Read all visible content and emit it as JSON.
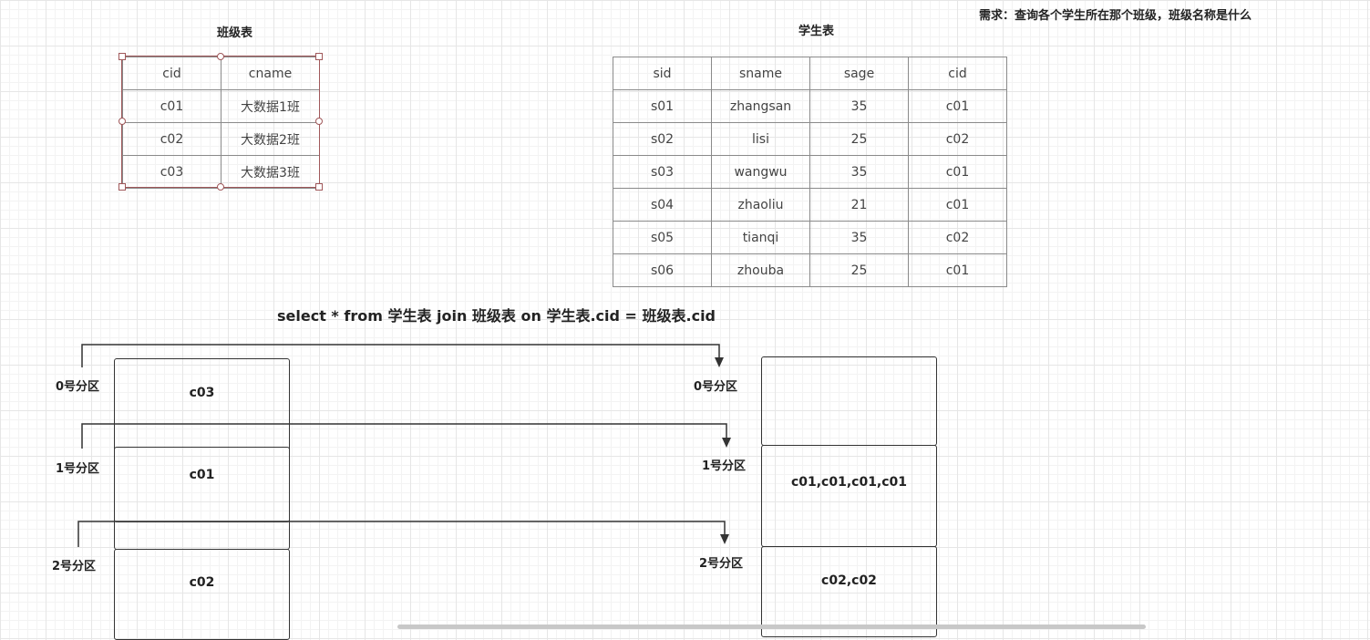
{
  "requirement": "需求：查询各个学生所在那个班级，班级名称是什么",
  "class_table": {
    "title": "班级表",
    "headers": [
      "cid",
      "cname"
    ],
    "rows": [
      [
        "c01",
        "大数据1班"
      ],
      [
        "c02",
        "大数据2班"
      ],
      [
        "c03",
        "大数据3班"
      ]
    ]
  },
  "student_table": {
    "title": "学生表",
    "headers": [
      "sid",
      "sname",
      "sage",
      "cid"
    ],
    "rows": [
      [
        "s01",
        "zhangsan",
        "35",
        "c01"
      ],
      [
        "s02",
        "lisi",
        "25",
        "c02"
      ],
      [
        "s03",
        "wangwu",
        "35",
        "c01"
      ],
      [
        "s04",
        "zhaoliu",
        "21",
        "c01"
      ],
      [
        "s05",
        "tianqi",
        "35",
        "c02"
      ],
      [
        "s06",
        "zhouba",
        "25",
        "c01"
      ]
    ]
  },
  "sql": "select * from 学生表 join  班级表  on 学生表.cid = 班级表.cid",
  "left_partitions": {
    "labels": [
      "0号分区",
      "1号分区",
      "2号分区"
    ],
    "blocks": [
      "c03",
      "c01",
      "c02"
    ]
  },
  "right_partitions": {
    "labels": [
      "0号分区",
      "1号分区",
      "2号分区"
    ],
    "blocks": [
      "",
      "c01,c01,c01,c01",
      "c02,c02"
    ]
  }
}
